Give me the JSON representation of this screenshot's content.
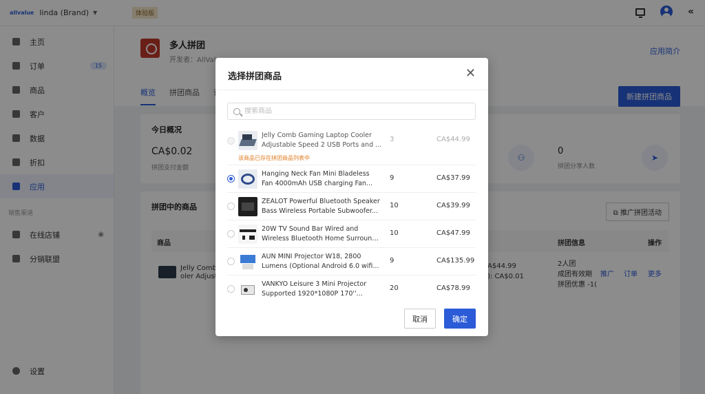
{
  "topbar": {
    "logo": "allvalue",
    "brand": "linda (Brand)",
    "trial_badge": "体验版",
    "icons": [
      "monitor-icon",
      "avatar",
      "collapse-icon"
    ]
  },
  "sidebar": {
    "items": [
      {
        "label": "主页",
        "icon": "home-icon"
      },
      {
        "label": "订单",
        "icon": "order-icon",
        "badge": "15"
      },
      {
        "label": "商品",
        "icon": "product-icon"
      },
      {
        "label": "客户",
        "icon": "customer-icon"
      },
      {
        "label": "数据",
        "icon": "data-icon"
      },
      {
        "label": "折扣",
        "icon": "discount-icon"
      },
      {
        "label": "应用",
        "icon": "apps-icon",
        "active": true
      }
    ],
    "section_label": "销售渠道",
    "channels": [
      {
        "label": "在线店铺",
        "icon": "store-icon",
        "eye": "eye-icon"
      },
      {
        "label": "分销联盟",
        "icon": "affiliate-icon"
      }
    ],
    "settings": "设置"
  },
  "app": {
    "title": "多人拼团",
    "developer": "开发者：AllVal",
    "intro_link": "应用简介",
    "tabs": [
      "概览",
      "拼团商品",
      "设"
    ],
    "new_button": "新建拼团商品"
  },
  "overview": {
    "title": "今日概况",
    "amount": "CA$0.02",
    "amount_label": "拼团支付金额",
    "share_count": "0",
    "share_label": "拼团分享人数"
  },
  "ongoing": {
    "title": "拼团中的商品",
    "promote_button": "推广拼团活动",
    "headers": {
      "product": "商品",
      "info": "拼团信息",
      "actions": "操作"
    },
    "row": {
      "name_line1": "Jelly Comb",
      "name_line2": "oler Adjusta",
      "price_line1": "A$44.99",
      "price_line2": "): CA$0.01",
      "info_line1": "2人团",
      "info_line2": "成团有效期",
      "info_line3": "拼团优惠 -1(",
      "actions": [
        "推广",
        "订单",
        "更多"
      ]
    }
  },
  "modal": {
    "title": "选择拼团商品",
    "search_placeholder": "搜索商品",
    "products": [
      {
        "line1": "Jelly Comb Gaming Laptop Cooler",
        "line2": "Adjustable Speed 2 USB Ports and ...",
        "qty": "3",
        "price": "CA$44.99",
        "state": "disabled",
        "warning": "该商品已存在拼团商品列表中"
      },
      {
        "line1": "Hanging Neck Fan Mini Bladeless",
        "line2": "Fan 4000mAh USB charging Fan...",
        "qty": "9",
        "price": "CA$37.99",
        "state": "checked"
      },
      {
        "line1": "ZEALOT Powerful Bluetooth Speaker",
        "line2": "Bass Wireless Portable Subwoofer...",
        "qty": "10",
        "price": "CA$39.99",
        "state": "normal"
      },
      {
        "line1": "20W TV Sound Bar Wired and",
        "line2": "Wireless Bluetooth Home Surround...",
        "qty": "10",
        "price": "CA$47.99",
        "state": "normal"
      },
      {
        "line1": "AUN MINI Projector W18, 2800",
        "line2": "Lumens (Optional Android 6.0 wifi...",
        "qty": "9",
        "price": "CA$135.99",
        "state": "normal"
      },
      {
        "line1": "VANKYO Leisure 3 Mini Projector",
        "line2": "Supported 1920*1080P 170''...",
        "qty": "20",
        "price": "CA$78.99",
        "state": "normal"
      }
    ],
    "cancel": "取消",
    "confirm": "确定"
  },
  "colors": {
    "accent": "#2b5bd7",
    "warning": "#e07b20",
    "overlay": "rgba(0,0,0,0.45)"
  }
}
